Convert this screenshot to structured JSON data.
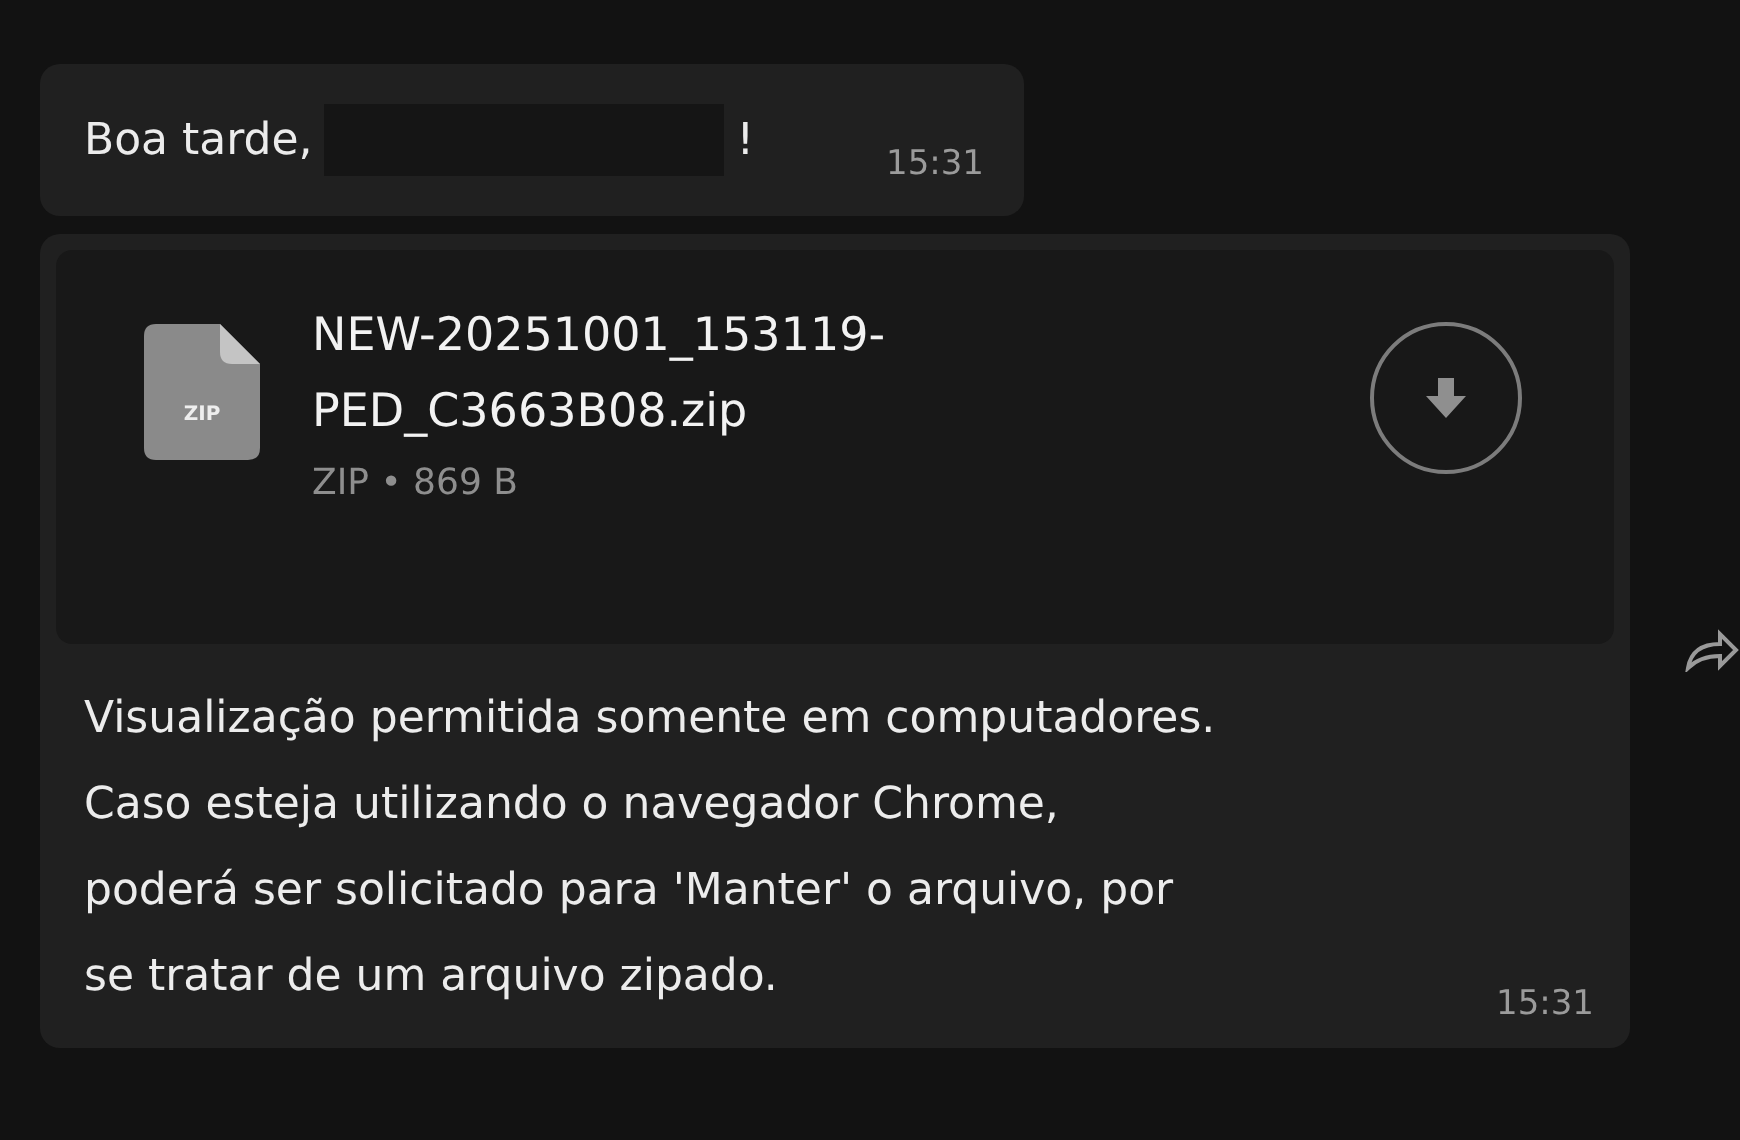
{
  "messages": [
    {
      "kind": "text",
      "parts": [
        "Boa tarde,",
        "!"
      ],
      "redacted": true,
      "time": "15:31"
    },
    {
      "kind": "file",
      "file": {
        "name": "NEW-20251001_153119-\nPED_C3663B08.zip",
        "icon_label": "ZIP",
        "type": "ZIP",
        "separator": "•",
        "size": "869 B"
      },
      "caption": "Visualização permitida somente em computadores.\nCaso esteja utilizando o navegador Chrome,\npoderá ser solicitado para 'Manter' o arquivo, por\nse tratar de um arquivo zipado.",
      "time": "15:31"
    }
  ]
}
